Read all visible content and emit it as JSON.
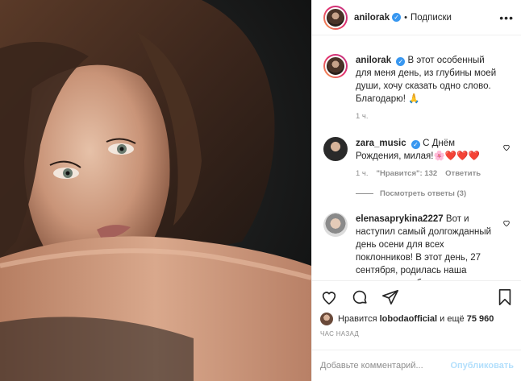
{
  "post": {
    "username": "anilorak",
    "follow_label": "Подписки",
    "more_label": "•••"
  },
  "comments": [
    {
      "username": "anilorak",
      "text": "В этот особенный для меня день, из глубины моей души, хочу сказать одно слово. Благодарю! 🙏",
      "time": "1 ч."
    },
    {
      "username": "zara_music",
      "text": "С Днём Рождения, милая!🌸❤️❤️❤️",
      "time": "1 ч.",
      "likes": "\"Нравится\": 132",
      "reply_label": "Ответить",
      "view_replies": "Посмотреть ответы (3)"
    },
    {
      "username": "elenasaprykina2227",
      "text": "Вот и наступил самый долгожданный день осени для всех поклонников! В этот день, 27 сентября, родилась наша кудрявая, улыбчивая малышка,"
    }
  ],
  "likes_line": {
    "prefix": "Нравится",
    "user": "lobodaofficial",
    "middle": "и ещё",
    "count": "75 960"
  },
  "time_ago": "ЧАС НАЗАД",
  "add_comment": {
    "placeholder": "Добавьте комментарий...",
    "publish_label": "Опубликовать"
  },
  "colors": {
    "accent": "#3897f0",
    "heart": "#ed4956",
    "muted": "#8e8e8e",
    "publish_disabled": "#b2dffc"
  }
}
